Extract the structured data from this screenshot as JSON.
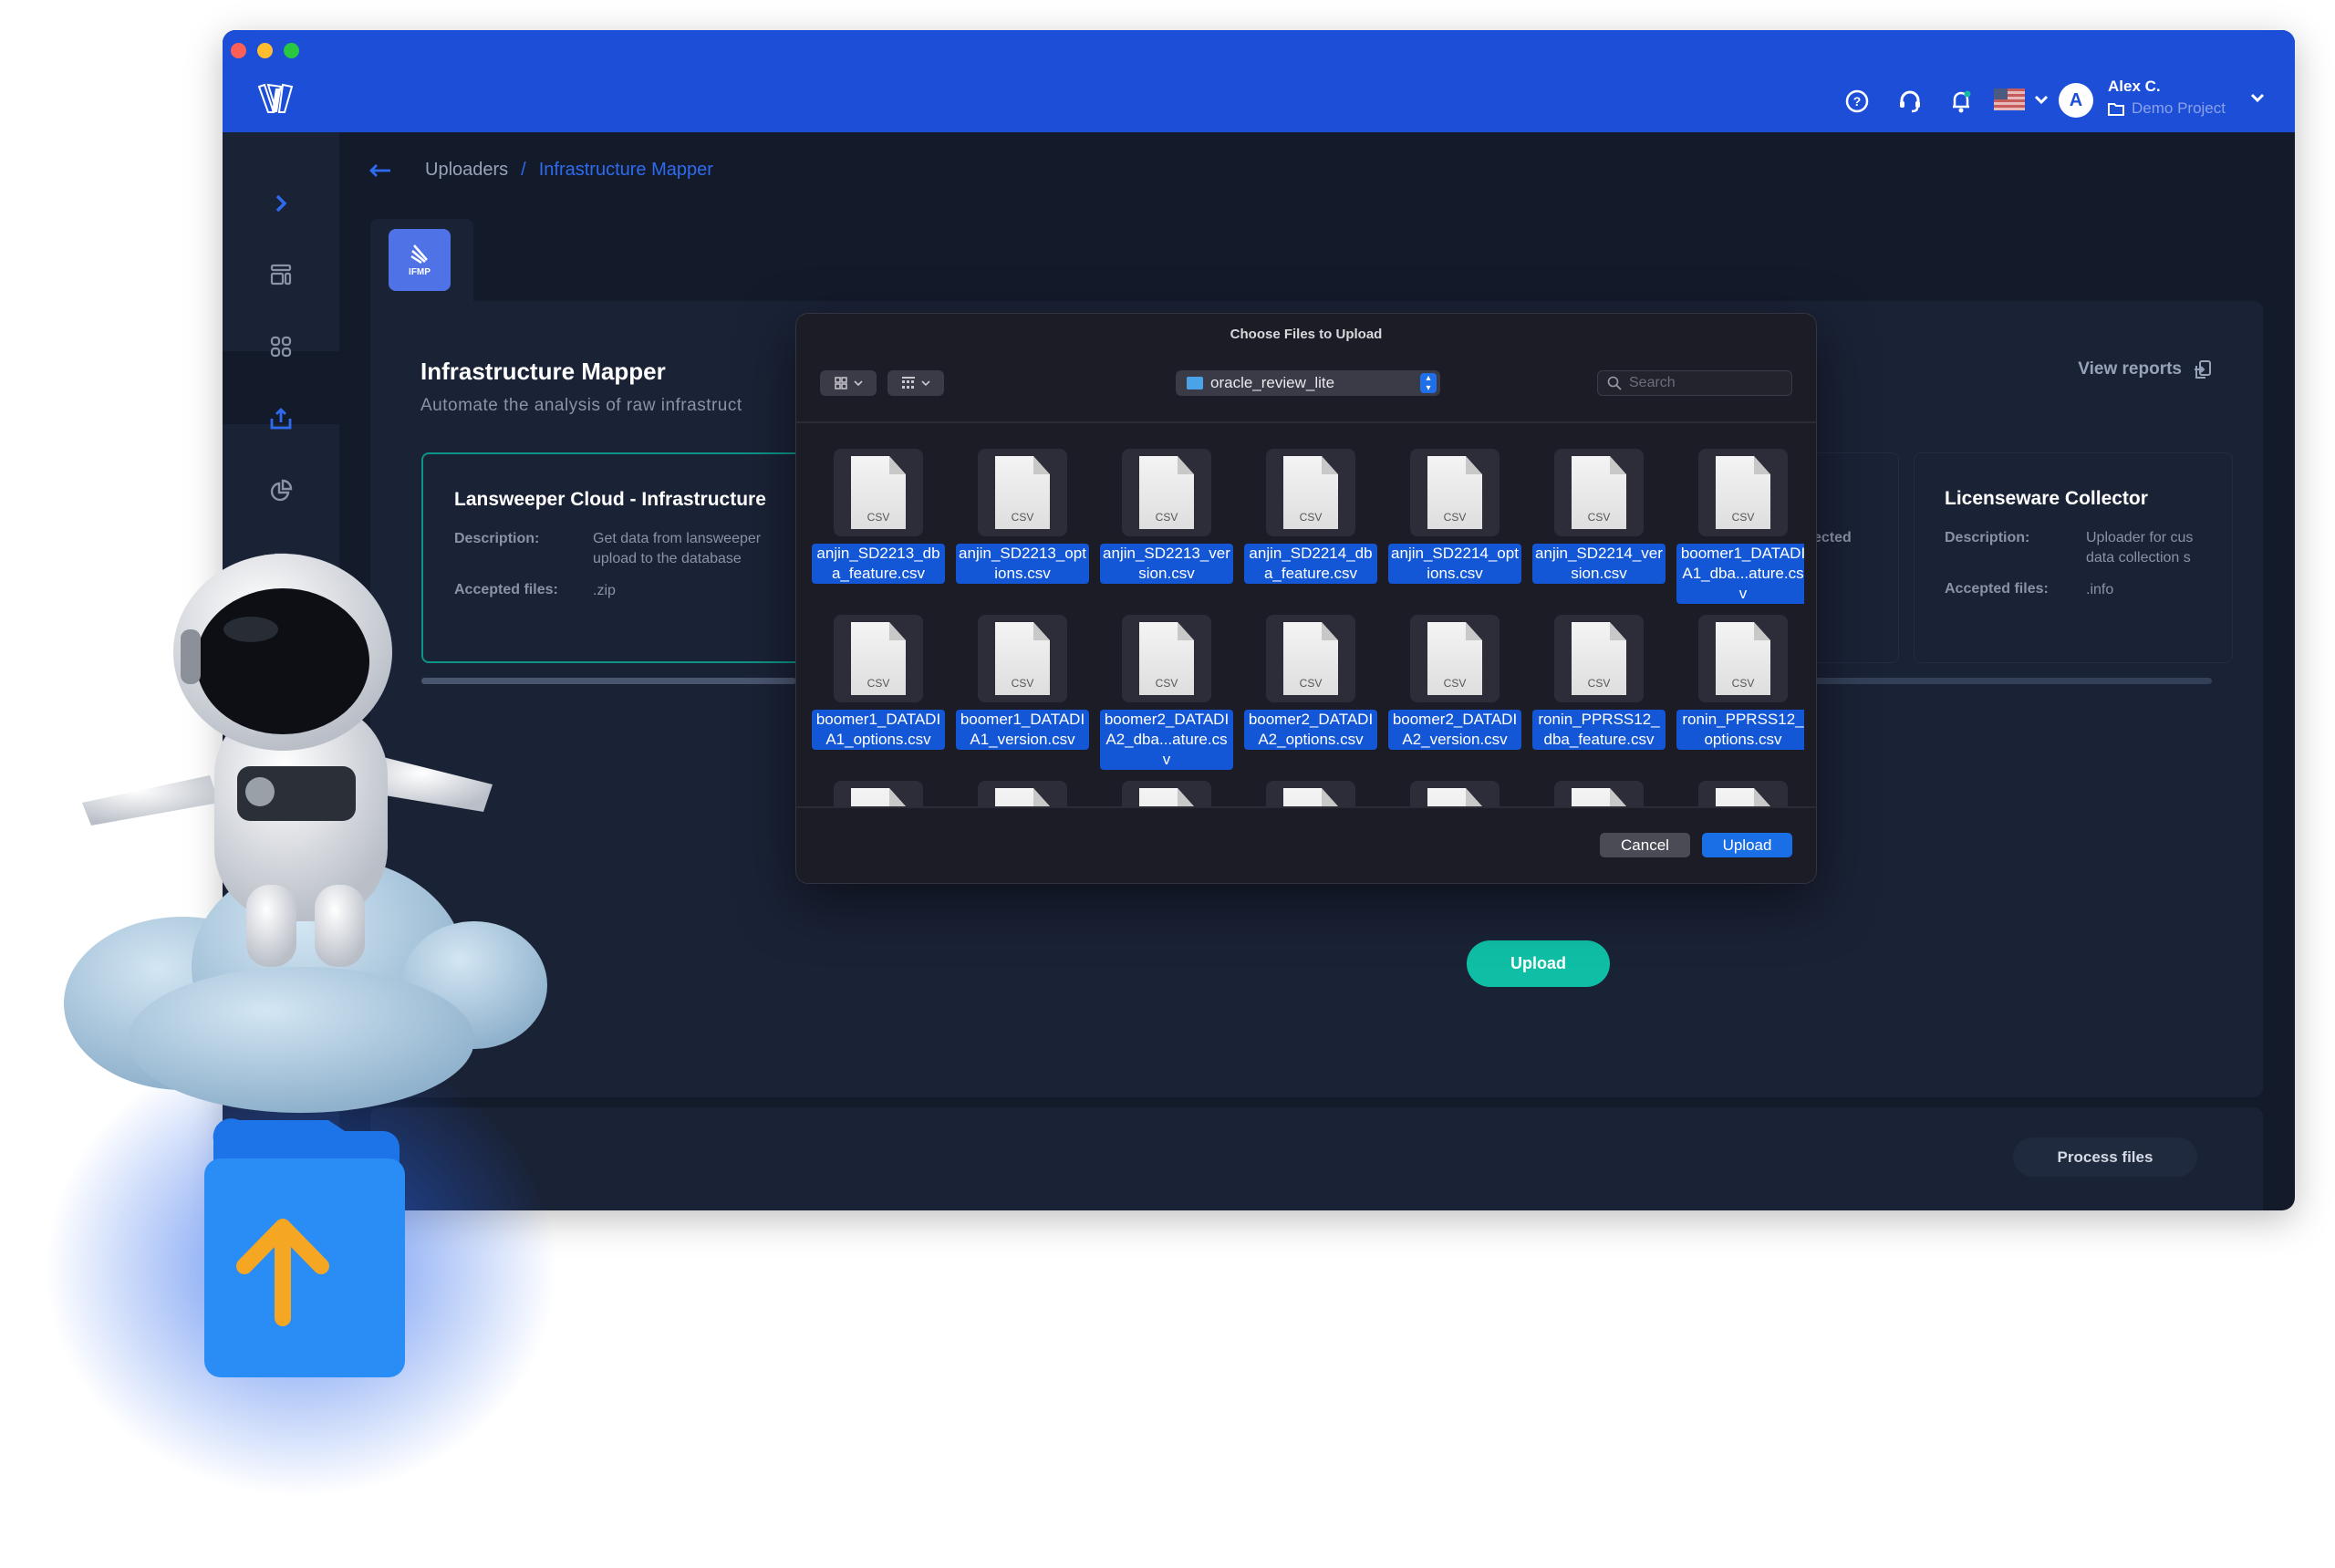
{
  "header": {
    "user_name": "Alex C.",
    "avatar_initial": "A",
    "project": "Demo Project",
    "language_flag": "us-flag",
    "icons": [
      "help-icon",
      "headset-icon",
      "bell-icon",
      "chevron-down-icon"
    ],
    "brand_color": "#1d4ed8"
  },
  "sidebar": {
    "items": [
      {
        "icon": "dashboard-icon"
      },
      {
        "icon": "apps-grid-icon"
      },
      {
        "icon": "upload-icon",
        "active": true
      },
      {
        "icon": "pie-chart-icon"
      },
      {
        "icon": "inbox-icon"
      }
    ]
  },
  "breadcrumb": {
    "parent": "Uploaders",
    "separator": "/",
    "current": "Infrastructure Mapper"
  },
  "tab": {
    "label": "IFMP"
  },
  "main": {
    "title": "Infrastructure Mapper",
    "subtitle": "Automate the analysis of raw infrastruct",
    "view_reports": "View reports",
    "upload_button": "Upload",
    "process_files": "Process files",
    "accent_color": "#0fbfa5",
    "cards": [
      {
        "title": "Lansweeper Cloud - Infrastructure",
        "desc_label": "Description:",
        "desc": "Get data from lansweeper upload to the database",
        "desc_line1": "Get data from lansweeper",
        "desc_line2": "upload to the database",
        "files_label": "Accepted files:",
        "files": ".zip",
        "selected": true
      },
      {
        "fragment": "ected"
      },
      {
        "title": "Licenseware Collector",
        "desc_label": "Description:",
        "desc_line1": "Uploader for cus",
        "desc_line2": "data collection s",
        "files_label": "Accepted files:",
        "files": ".info"
      }
    ]
  },
  "dialog": {
    "title": "Choose Files to Upload",
    "folder": "oracle_review_lite",
    "search_placeholder": "Search",
    "cancel": "Cancel",
    "upload": "Upload",
    "file_type": "CSV",
    "files": [
      "anjin_SD2213_dba_feature.csv",
      "anjin_SD2213_options.csv",
      "anjin_SD2213_version.csv",
      "anjin_SD2214_dba_feature.csv",
      "anjin_SD2214_options.csv",
      "anjin_SD2214_version.csv",
      "boomer1_DATADIA1_dba...ature.csv",
      "boomer1_DATADIA1_options.csv",
      "boomer1_DATADIA1_version.csv",
      "boomer2_DATADIA2_dba...ature.csv",
      "boomer2_DATADIA2_options.csv",
      "boomer2_DATADIA2_version.csv",
      "ronin_PPRSS12_dba_feature.csv",
      "ronin_PPRSS12_options.csv"
    ]
  }
}
